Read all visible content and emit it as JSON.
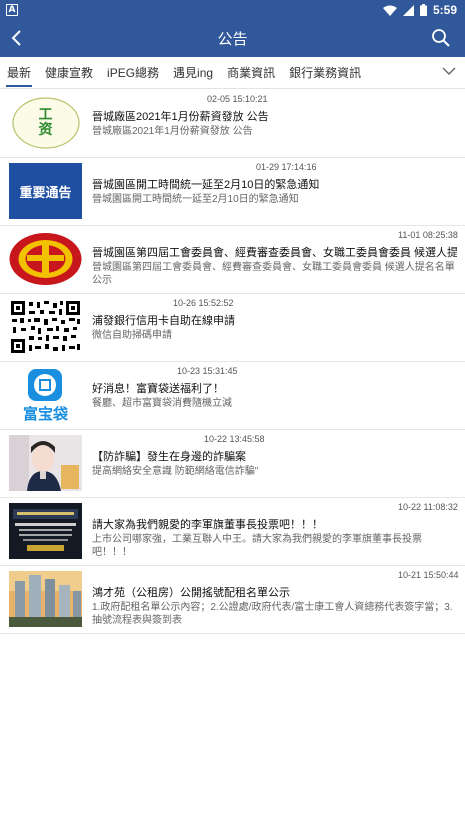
{
  "status_bar": {
    "time": "5:59",
    "badge": "A"
  },
  "app_bar": {
    "title": "公告"
  },
  "tabs": [
    {
      "label": "最新"
    },
    {
      "label": "健康宣教"
    },
    {
      "label": "iPEG總務"
    },
    {
      "label": "遇見ing"
    },
    {
      "label": "商業資訊"
    },
    {
      "label": "銀行業務資訊"
    }
  ],
  "items": [
    {
      "timestamp": "02-05 15:10:21",
      "title": "晉城廠區2021年1月份薪資發放 公告",
      "subtitle": "晉城廠區2021年1月份薪資發放 公告",
      "thumb_text": "工\n资",
      "thumb_type": "wage-logo"
    },
    {
      "timestamp": "01-29 17:14:16",
      "title": "晉城園區開工時間統一延至2月10日的緊急通知",
      "subtitle": "晉城園區開工時間統一延至2月10日的緊急通知",
      "thumb_text": "重要通告",
      "thumb_type": "notice"
    },
    {
      "timestamp": "11-01 08:25:38",
      "title": "晉城園區第四屆工會委員會、經費審查委員會、女職工委員會委員 候選人提...",
      "subtitle": "晉城園區第四屆工會委員會、經費審查委員會、女職工委員會委員 候選人提名名單公示",
      "thumb_type": "union-emblem"
    },
    {
      "timestamp": "10-26 15:52:52",
      "title": "浦發銀行信用卡自助在線申請",
      "subtitle": "微信自助掃碼申請",
      "thumb_type": "qr-code"
    },
    {
      "timestamp": "10-23 15:31:45",
      "title": "好消息！富寶袋送福利了！",
      "subtitle": "餐廳、超市富寶袋消費隨機立減",
      "thumb_text": "富宝袋",
      "thumb_type": "fubao"
    },
    {
      "timestamp": "10-22 13:45:58",
      "title": "【防詐騙】發生在身邊的詐騙案",
      "subtitle": "提高網絡安全意識 防範網絡電信詐騙\"",
      "thumb_type": "police-photo"
    },
    {
      "timestamp": "10-22 11:08:32",
      "title": "請大家為我們親愛的李軍旗董事長投票吧！！！",
      "subtitle": "上市公司哪家強，工業互聯人中王。請大家為我們親愛的李軍旗董事長投票吧！！！",
      "thumb_type": "award-photo"
    },
    {
      "timestamp": "10-21 15:50:44",
      "title": "鴻才苑（公租房）公開搖號配租名單公示",
      "subtitle": "1.政府配租名單公示內容；2.公證處/政府代表/富士康工會人資總務代表簽字當；3.抽號流程表與簽到表",
      "thumb_type": "building-photo"
    }
  ],
  "colors": {
    "primary": "#30589a",
    "notice_blue": "#1e4fa1",
    "union_red": "#c8161d",
    "wage_green": "#2e8b2e"
  }
}
